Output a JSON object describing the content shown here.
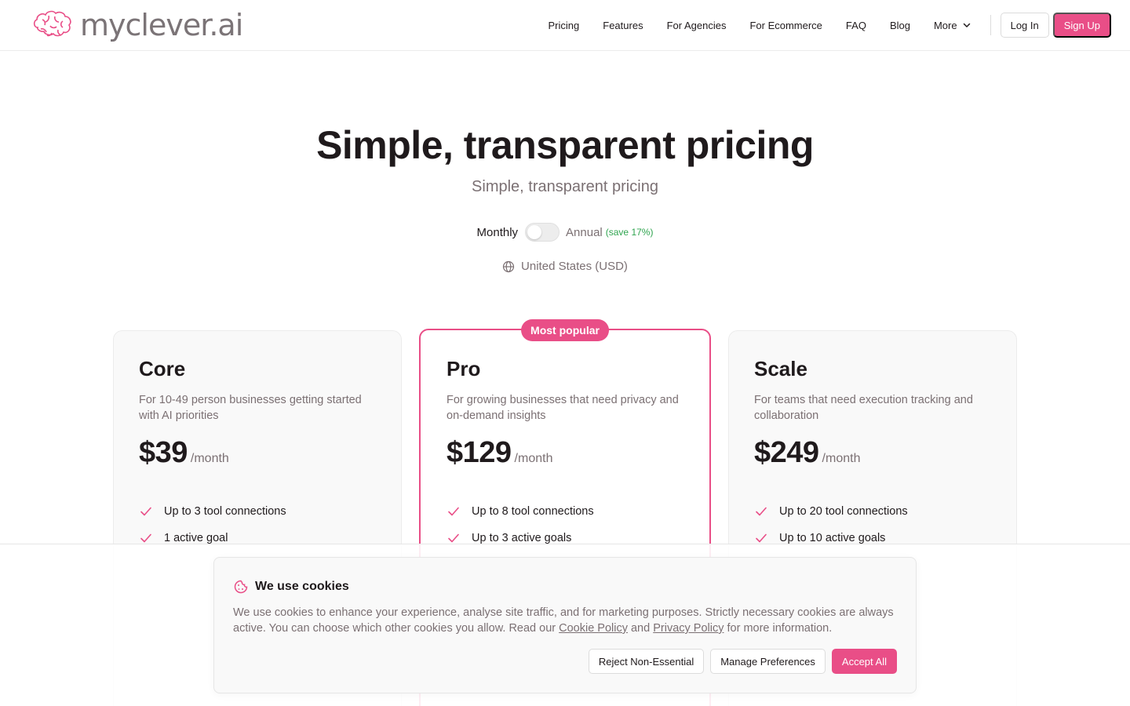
{
  "brand": {
    "name": "myclever.ai",
    "accent": "#e94e87"
  },
  "nav": {
    "items": [
      "Pricing",
      "Features",
      "For Agencies",
      "For Ecommerce",
      "FAQ",
      "Blog"
    ],
    "more_label": "More",
    "login_label": "Log In",
    "signup_label": "Sign Up"
  },
  "hero": {
    "title": "Simple, transparent pricing",
    "subtitle": "Simple, transparent pricing"
  },
  "billing": {
    "monthly_label": "Monthly",
    "annual_label": "Annual",
    "save_label": "(save 17%)",
    "annual_selected": false
  },
  "region": {
    "label": "United States (USD)",
    "icon": "globe-icon"
  },
  "plans": [
    {
      "name": "Core",
      "description": "For 10-49 person businesses getting started with AI priorities",
      "price": "$39",
      "period": "/month",
      "features": [
        "Up to 3 tool connections",
        "1 active goal"
      ]
    },
    {
      "name": "Pro",
      "badge": "Most popular",
      "description": "For growing businesses that need privacy and on-demand insights",
      "price": "$129",
      "period": "/month",
      "features": [
        "Up to 8 tool connections",
        "Up to 3 active goals"
      ]
    },
    {
      "name": "Scale",
      "description": "For teams that need execution tracking and collaboration",
      "price": "$249",
      "period": "/month",
      "features": [
        "Up to 20 tool connections",
        "Up to 10 active goals"
      ]
    }
  ],
  "cookie": {
    "title": "We use cookies",
    "text_before": "We use cookies to enhance your experience, analyse site traffic, and for marketing purposes. Strictly necessary cookies are always active. You can choose which other cookies you allow. Read our ",
    "cookie_policy_link": "Cookie Policy",
    "text_and": " and ",
    "privacy_policy_link": "Privacy Policy",
    "text_after": " for more information.",
    "reject_label": "Reject Non-Essential",
    "manage_label": "Manage Preferences",
    "accept_label": "Accept All"
  }
}
